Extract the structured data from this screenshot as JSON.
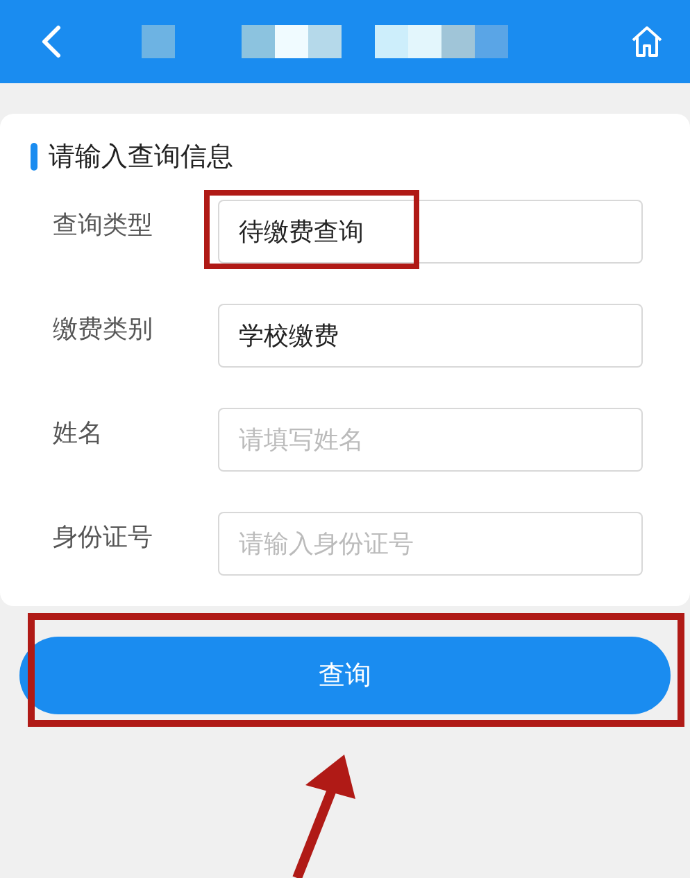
{
  "header": {
    "kind": "obscured"
  },
  "form": {
    "title": "请输入查询信息",
    "fields": [
      {
        "label": "查询类型",
        "value": "待缴费查询",
        "highlighted": true
      },
      {
        "label": "缴费类别",
        "value": "学校缴费",
        "highlighted": false
      },
      {
        "label": "姓名",
        "placeholder": "请填写姓名",
        "highlighted": false
      },
      {
        "label": "身份证号",
        "placeholder": "请输入身份证号",
        "highlighted": false
      }
    ]
  },
  "submit": {
    "label": "查询",
    "highlighted": true
  }
}
